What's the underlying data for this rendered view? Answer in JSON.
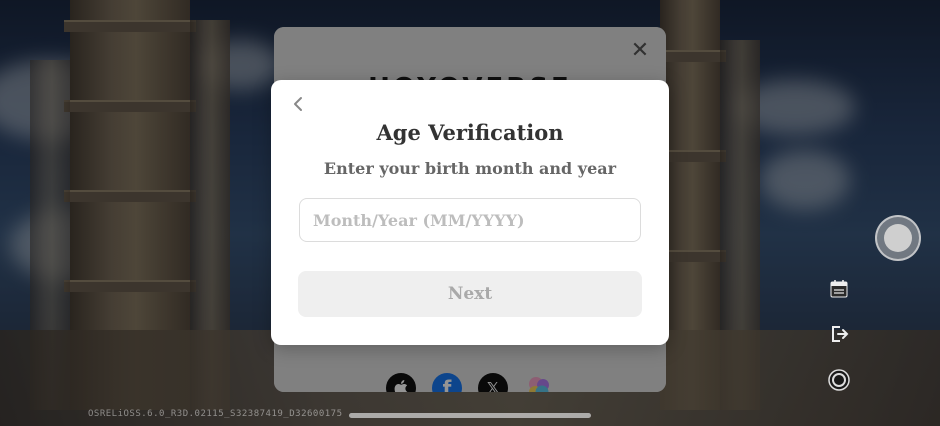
{
  "login_panel": {
    "logo_text": "HOYOVERSE",
    "social_login": [
      {
        "name": "apple",
        "color": "#111111"
      },
      {
        "name": "facebook",
        "color": "#1877f2"
      },
      {
        "name": "x",
        "color": "#111111"
      },
      {
        "name": "game-center",
        "color": "#e8a6d0"
      }
    ]
  },
  "modal": {
    "title": "Age Verification",
    "subtitle": "Enter your birth month and year",
    "input_placeholder": "Month/Year (MM/YYYY)",
    "input_value": "",
    "next_label": "Next"
  },
  "footer": {
    "build_text": "OSRELiOSS.6.0_R3D.02115_S32387419_D32600175"
  },
  "colors": {
    "modal_bg": "#ffffff",
    "button_disabled_bg": "#efefef",
    "button_disabled_text": "#a9a9a9"
  }
}
